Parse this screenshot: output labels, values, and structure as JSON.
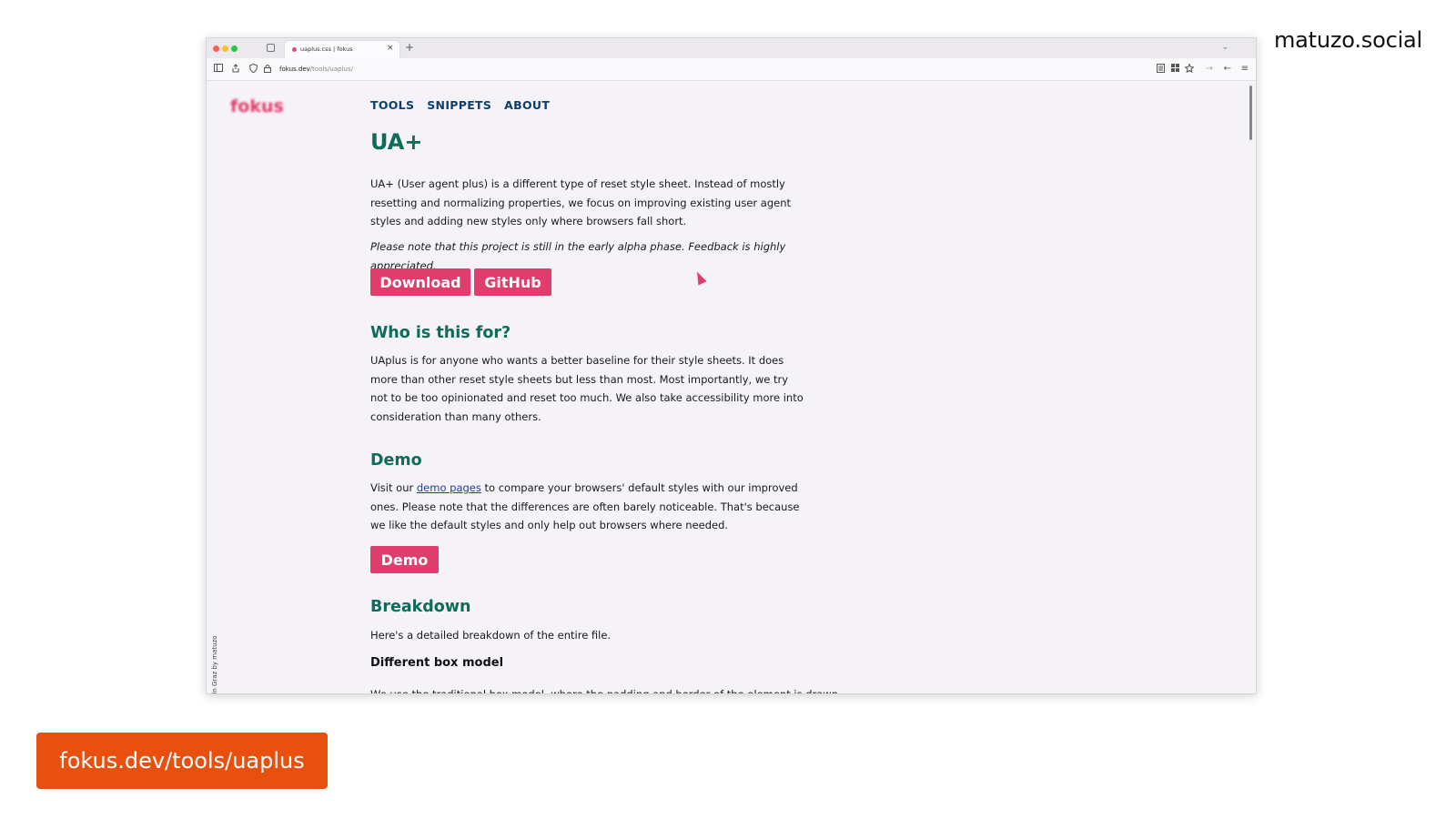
{
  "watermark": "matuzo.social",
  "url_badge": "fokus.dev/tools/uaplus",
  "browser": {
    "tab_title": "uaplus.css | fokus",
    "tab_close": "×",
    "new_tab": "+",
    "tabs_menu": "⌄",
    "url_host": "fokus.dev",
    "url_path": "/tools/uaplus/"
  },
  "site": {
    "logo": "fokus",
    "side_credit": "built with eleventy in Graz by matuzo",
    "nav": [
      "TOOLS",
      "SNIPPETS",
      "ABOUT"
    ],
    "title": "UA+",
    "intro": "UA+ (User agent plus) is a different type of reset style sheet. Instead of mostly resetting and normalizing properties, we focus on improving existing user agent styles and adding new styles only where browsers fall short.",
    "note": "Please note that this project is still in the early alpha phase. Feedback is highly appreciated.",
    "buttons": {
      "download": "Download",
      "github": "GitHub",
      "demo": "Demo"
    },
    "who_heading": "Who is this for?",
    "who_text": "UAplus is for anyone who wants a better baseline for their style sheets. It does more than other reset style sheets but less than most. Most importantly, we try not to be too opinionated and reset too much. We also take accessibility more into consideration than many others.",
    "demo_heading": "Demo",
    "demo_text_before": "Visit our ",
    "demo_link": "demo pages",
    "demo_text_after": " to compare your browsers' default styles with our improved ones. Please note that the differences are often barely noticeable. That's because we like the default styles and only help out browsers where needed.",
    "breakdown_heading": "Breakdown",
    "breakdown_text": "Here's a detailed breakdown of the entire file.",
    "box_model_heading": "Different box model",
    "box_model_text": "We use the traditional box model, where the padding and border of the element is drawn"
  }
}
